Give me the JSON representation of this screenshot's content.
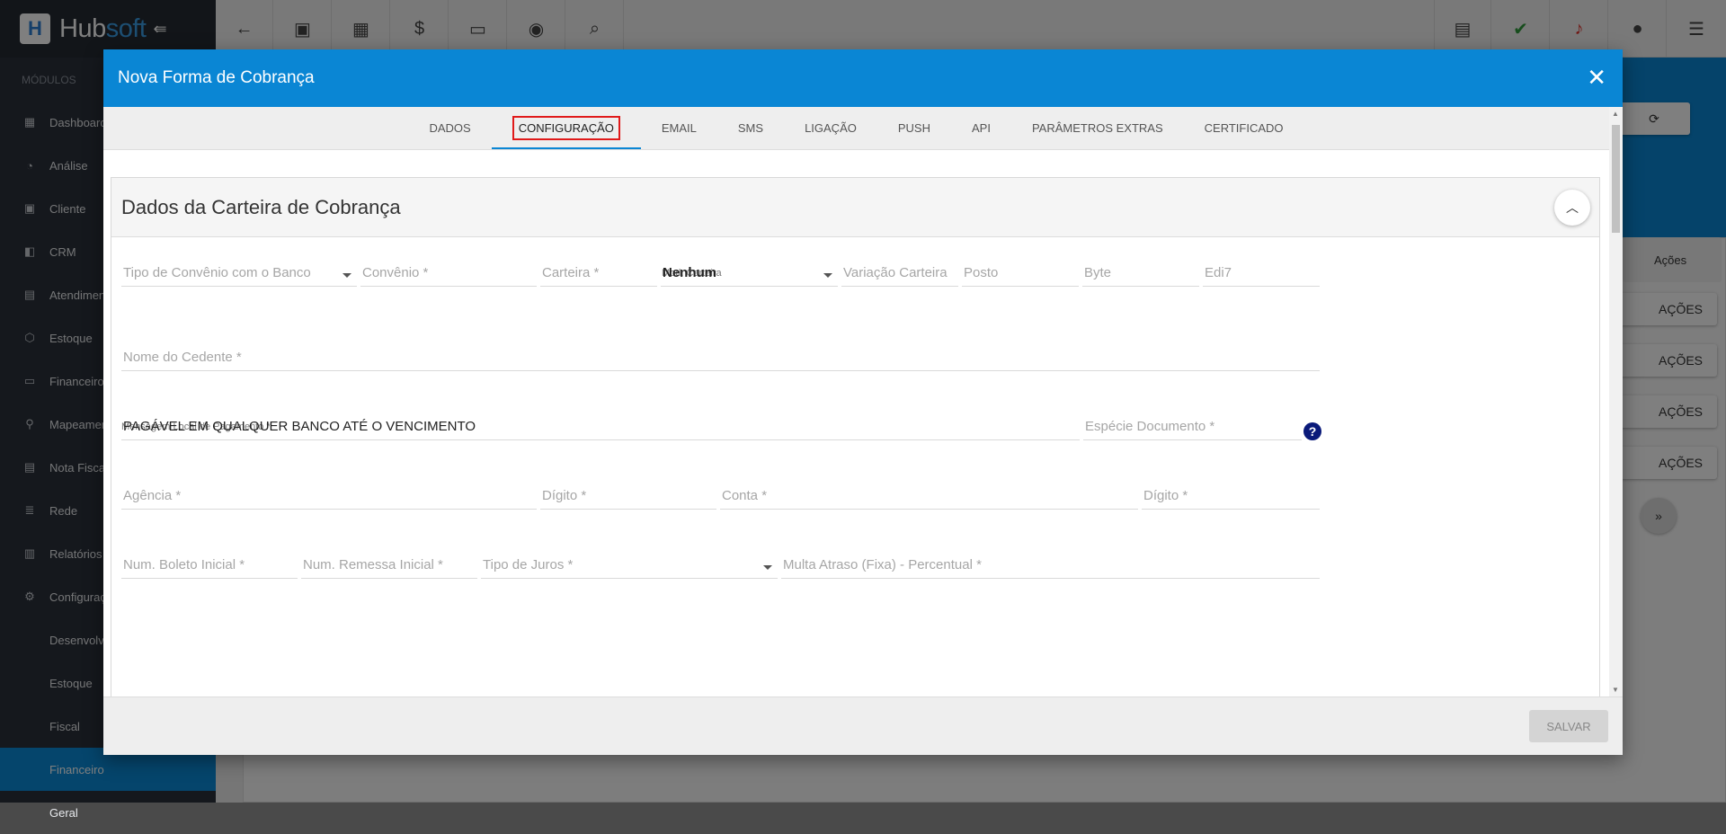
{
  "brand": {
    "name_a": "Hub",
    "name_b": "soft"
  },
  "sidebar": {
    "heading": "MÓDULOS",
    "items": [
      {
        "label": "Dashboard",
        "icon": "dashboard-icon"
      },
      {
        "label": "Análise",
        "icon": "pie-icon"
      },
      {
        "label": "Cliente",
        "icon": "contact-icon"
      },
      {
        "label": "CRM",
        "icon": "crm-icon"
      },
      {
        "label": "Atendimento",
        "icon": "calendar-icon"
      },
      {
        "label": "Estoque",
        "icon": "box-icon"
      },
      {
        "label": "Financeiro",
        "icon": "money-icon"
      },
      {
        "label": "Mapeamento",
        "icon": "map-pin-icon"
      },
      {
        "label": "Nota Fiscal",
        "icon": "document-icon"
      },
      {
        "label": "Rede",
        "icon": "server-icon"
      },
      {
        "label": "Relatórios",
        "icon": "report-icon"
      },
      {
        "label": "Configurações",
        "icon": "gear-icon"
      }
    ],
    "subitems": [
      "Desenvolvedor",
      "Estoque",
      "Fiscal",
      "Financeiro",
      "Geral"
    ]
  },
  "background": {
    "actions_header": "Ações",
    "action_button": "AÇÕES"
  },
  "modal": {
    "title": "Nova Forma de Cobrança",
    "tabs": [
      "DADOS",
      "CONFIGURAÇÃO",
      "EMAIL",
      "SMS",
      "LIGAÇÃO",
      "PUSH",
      "API",
      "PARÂMETROS EXTRAS",
      "CERTIFICADO"
    ],
    "active_tab": "CONFIGURAÇÃO",
    "section_title": "Dados da Carteira de Cobrança",
    "fields": {
      "tipo_convenio": "Tipo de Convênio com o Banco",
      "convenio": "Convênio *",
      "carteira": "Carteira *",
      "mod_carteira_label": "Mod. Carteira",
      "mod_carteira_value": "Nenhum",
      "variacao_carteira": "Variação Carteira",
      "posto": "Posto",
      "byte": "Byte",
      "edi7": "Edi7",
      "nome_cedente": "Nome do Cedente *",
      "mensagem_label": "Mensagem Local de Pagamento *",
      "mensagem_value": "PAGÁVEL EM QUALQUER BANCO ATÉ O VENCIMENTO",
      "especie_documento": "Espécie Documento *",
      "agencia": "Agência *",
      "digito_agencia": "Dígito *",
      "conta": "Conta *",
      "digito_conta": "Dígito *",
      "num_boleto": "Num. Boleto Inicial *",
      "num_remessa": "Num. Remessa Inicial *",
      "tipo_juros": "Tipo de Juros *",
      "multa_atraso": "Multa Atraso (Fixa) - Percentual *"
    },
    "save_label": "SALVAR"
  }
}
